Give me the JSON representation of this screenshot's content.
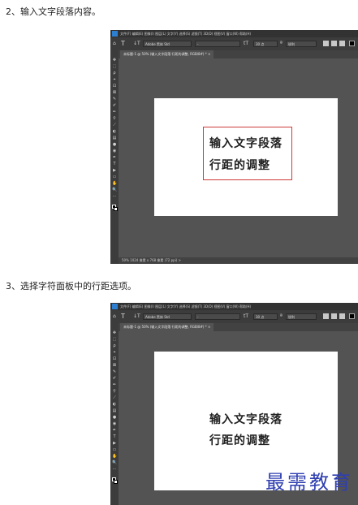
{
  "step2": "2、输入文字段落内容。",
  "step3": "3、选择字符面板中的行距选项。",
  "ps": {
    "menubar": "文件(F)  编辑(E)  图像(I)  图层(L)  文字(Y)  选择(S)  滤镜(T)  3D(D)  视图(V)  窗口(W)  帮助(H)",
    "opt_home": "⌂",
    "opt_t": "T",
    "opt_orient": "↓T",
    "font_family": "Adobe 黑体 Std",
    "font_style": "-",
    "font_size_icon": "tT",
    "font_size": "30 点",
    "aa_label": "ª",
    "aa_value": "锐利",
    "doc_tab": "未标题-1 @ 50% (输入文字段落 行距的调整, RGB/8#) *  ×",
    "status": "50%     1024 像素 x 768 像素 (72 ppi)   >",
    "line1": "输入文字段落",
    "line2": "行距的调整",
    "tools": [
      "✥",
      "⬚",
      "ρ",
      "⌖",
      "⊡",
      "⊠",
      "✎",
      "✐",
      "✏",
      "⚲",
      "⟋",
      "◐",
      "▤",
      "●",
      "◉",
      "✒",
      "T",
      "▶",
      "▭",
      "✋",
      "🔍",
      "⋯"
    ]
  },
  "watermark": "最需教育"
}
